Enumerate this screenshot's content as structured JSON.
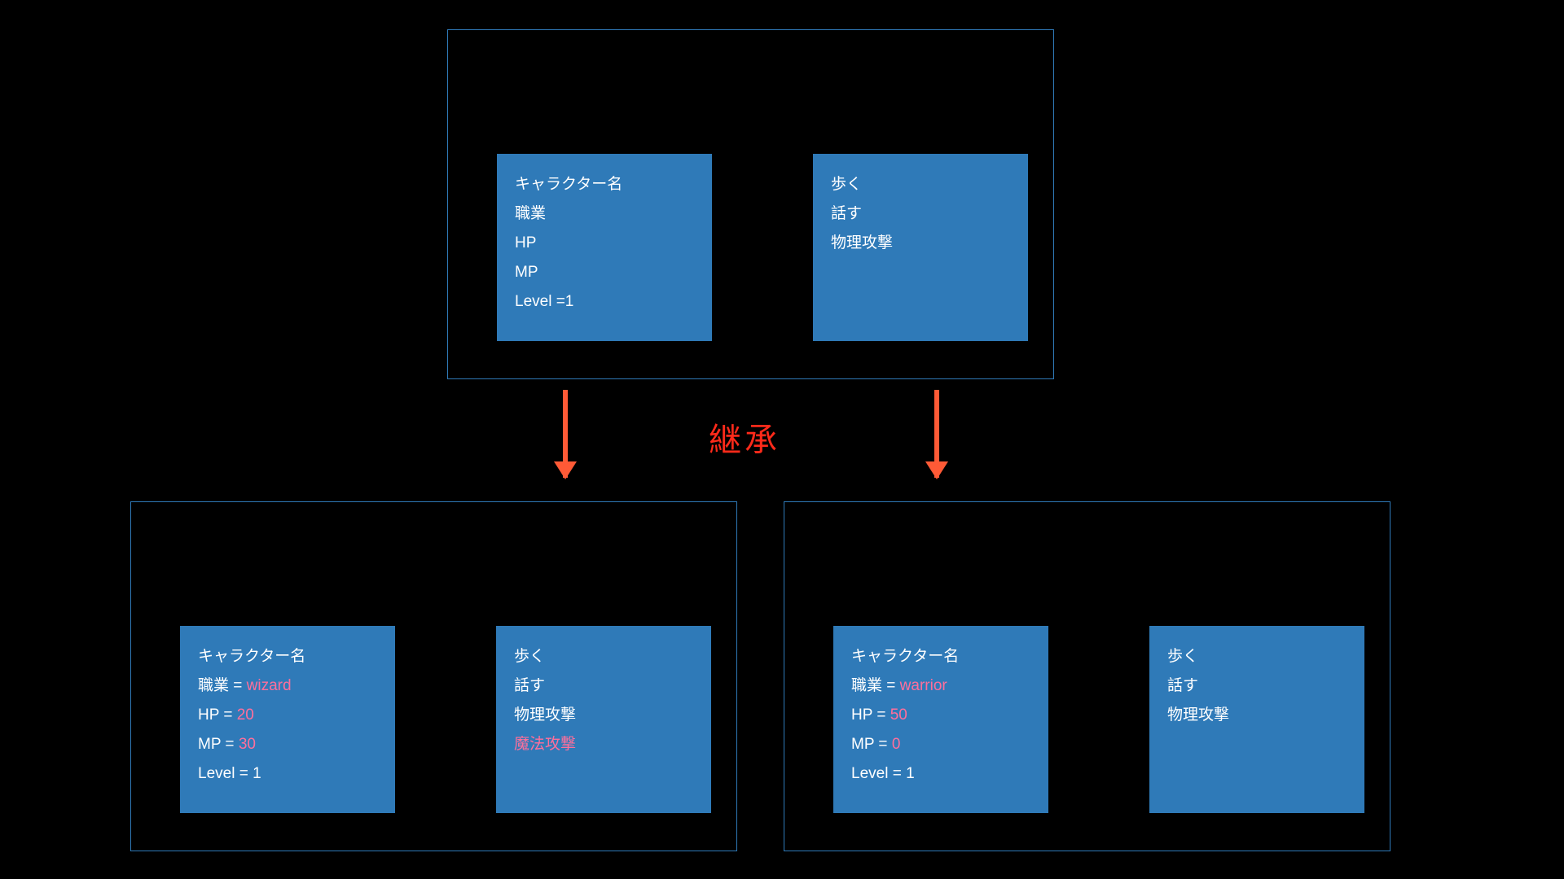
{
  "inheritLabel": "継承",
  "parent": {
    "attrs": {
      "charName": "キャラクター名",
      "job": "職業",
      "hp": "HP",
      "mp": "MP",
      "level": "Level =1"
    },
    "methods": {
      "walk": "歩く",
      "talk": "話す",
      "physAttack": "物理攻撃"
    }
  },
  "wizard": {
    "attrs": {
      "charName": "キャラクター名",
      "jobLabel": "職業 = ",
      "jobValue": "wizard",
      "hpLabel": "HP = ",
      "hpValue": "20",
      "mpLabel": "MP = ",
      "mpValue": "30",
      "level": "Level = 1"
    },
    "methods": {
      "walk": "歩く",
      "talk": "話す",
      "physAttack": "物理攻撃",
      "magicAttack": "魔法攻撃"
    }
  },
  "warrior": {
    "attrs": {
      "charName": "キャラクター名",
      "jobLabel": "職業 = ",
      "jobValue": "warrior",
      "hpLabel": "HP = ",
      "hpValue": "50",
      "mpLabel": "MP = ",
      "mpValue": "0",
      "level": "Level = 1"
    },
    "methods": {
      "walk": "歩く",
      "talk": "話す",
      "physAttack": "物理攻撃"
    }
  }
}
